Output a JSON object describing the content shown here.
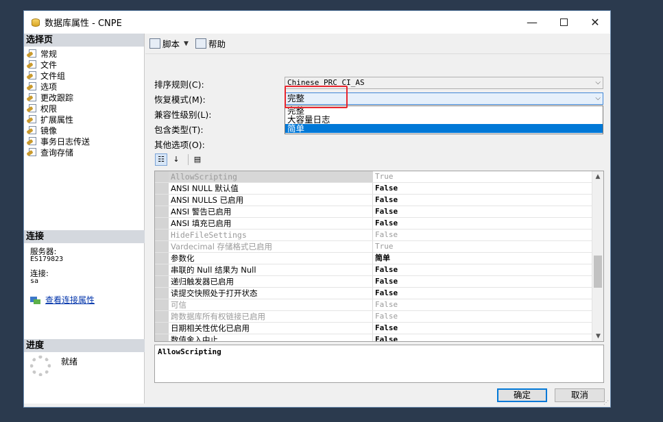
{
  "window": {
    "title": "数据库属性 - CNPE",
    "icon": "database-icon"
  },
  "sidebar": {
    "select_page_header": "选择页",
    "items": [
      {
        "label": "常规"
      },
      {
        "label": "文件"
      },
      {
        "label": "文件组"
      },
      {
        "label": "选项"
      },
      {
        "label": "更改跟踪"
      },
      {
        "label": "权限"
      },
      {
        "label": "扩展属性"
      },
      {
        "label": "镜像"
      },
      {
        "label": "事务日志传送"
      },
      {
        "label": "查询存储"
      }
    ],
    "connection_header": "连接",
    "server_label": "服务器:",
    "server_value": "ES179823",
    "connection_label": "连接:",
    "connection_value": "sa",
    "view_connection_link": "查看连接属性",
    "progress_header": "进度",
    "progress_status": "就绪"
  },
  "toolbar": {
    "script_label": "脚本",
    "help_label": "帮助"
  },
  "form": {
    "collation_label": "排序规则(C):",
    "collation_value": "Chinese_PRC_CI_AS",
    "recovery_label": "恢复模式(M):",
    "recovery_value": "完整",
    "recovery_options": [
      "完整",
      "大容量日志",
      "简单"
    ],
    "recovery_selected_option": "简单",
    "compat_label": "兼容性级别(L):",
    "containment_label": "包含类型(T):",
    "other_options_label": "其他选项(O):"
  },
  "property_grid": {
    "rows": [
      {
        "name": "AllowScripting",
        "value": "True"
      },
      {
        "name": "ANSI NULL 默认值",
        "value": "False"
      },
      {
        "name": "ANSI NULLS 已启用",
        "value": "False"
      },
      {
        "name": "ANSI 警告已启用",
        "value": "False"
      },
      {
        "name": "ANSI 填充已启用",
        "value": "False"
      },
      {
        "name": "HideFileSettings",
        "value": "False"
      },
      {
        "name": "Vardecimal 存储格式已启用",
        "value": "True"
      },
      {
        "name": "参数化",
        "value": "简单"
      },
      {
        "name": "串联的 Null 结果为 Null",
        "value": "False"
      },
      {
        "name": "递归触发器已启用",
        "value": "False"
      },
      {
        "name": "读提交快照处于打开状态",
        "value": "False"
      },
      {
        "name": "可信",
        "value": "False"
      },
      {
        "name": "跨数据库所有权链接已启用",
        "value": "False"
      },
      {
        "name": "日期相关性优化已启用",
        "value": "False"
      },
      {
        "name": "数值舍入中止",
        "value": "False"
      }
    ],
    "description": "AllowScripting"
  },
  "buttons": {
    "ok_label": "确定",
    "cancel_label": "取消"
  },
  "colors": {
    "highlight_box": "#e8242d",
    "selection_blue": "#0078d7"
  }
}
